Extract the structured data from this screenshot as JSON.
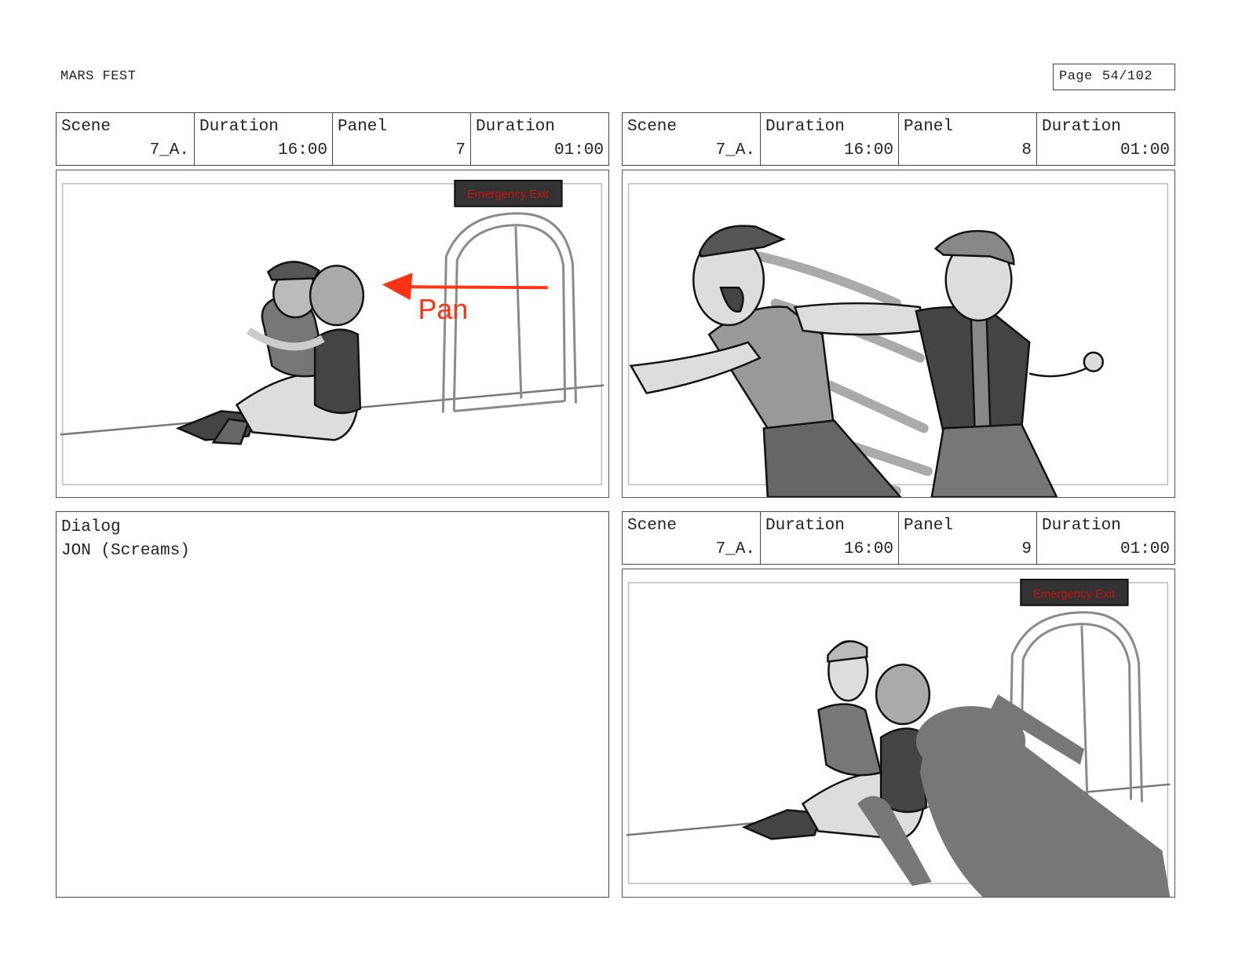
{
  "header": {
    "title": "MARS FEST",
    "page_label": "Page",
    "page_value": "54/102"
  },
  "labels": {
    "scene": "Scene",
    "duration": "Duration",
    "panel": "Panel",
    "dialog": "Dialog"
  },
  "panels": [
    {
      "scene": "7_A.",
      "scene_duration": "16:00",
      "panel": "7",
      "panel_duration": "01:00",
      "sign_text": "Emergency Exit",
      "annotation": "Pan"
    },
    {
      "scene": "7_A.",
      "scene_duration": "16:00",
      "panel": "8",
      "panel_duration": "01:00"
    },
    {
      "scene": "7_A.",
      "scene_duration": "16:00",
      "panel": "9",
      "panel_duration": "01:00",
      "sign_text": "Emergency Exit"
    }
  ],
  "dialog": {
    "text": "JON (Screams)"
  },
  "colors": {
    "border": "#444444",
    "sign_red": "#cc1111",
    "annotation_red": "#ff3311"
  }
}
